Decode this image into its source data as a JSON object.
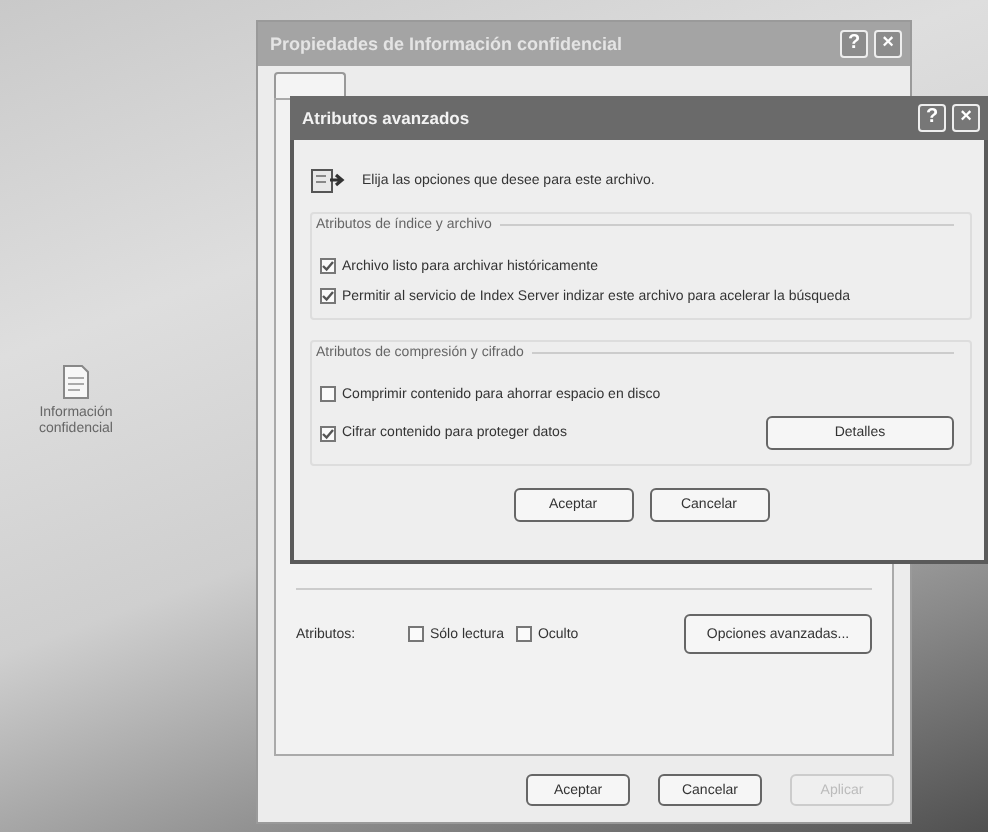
{
  "desktop": {
    "icon_label": "Información confidencial"
  },
  "properties_window": {
    "title": "Propiedades de Información confidencial",
    "title_buttons": [
      "?",
      "×"
    ],
    "attributes_label": "Atributos:",
    "attributes": [
      {
        "label": "Sólo lectura",
        "checked": false
      },
      {
        "label": "Oculto",
        "checked": false
      }
    ],
    "advanced_button": "Opciones avanzadas...",
    "buttons": [
      {
        "label": "Aceptar",
        "disabled": false
      },
      {
        "label": "Cancelar",
        "disabled": false
      },
      {
        "label": "Aplicar",
        "disabled": true
      }
    ]
  },
  "advanced_dialog": {
    "title": "Atributos avanzados",
    "title_buttons": [
      "?",
      "×"
    ],
    "intro": "Elija las opciones que desee para este archivo.",
    "groups": [
      {
        "title": "Atributos de índice y archivo",
        "options": [
          {
            "label": "Archivo listo para archivar históricamente",
            "checked": true
          },
          {
            "label": "Permitir al servicio de Index Server indizar este archivo para acelerar la búsqueda",
            "checked": true
          }
        ]
      },
      {
        "title": "Atributos de compresión y cifrado",
        "options": [
          {
            "label": "Comprimir contenido para ahorrar espacio en disco",
            "checked": false
          },
          {
            "label": "Cifrar contenido para proteger datos",
            "checked": true
          }
        ],
        "button": "Detalles"
      }
    ],
    "buttons": [
      "Aceptar",
      "Cancelar"
    ]
  }
}
